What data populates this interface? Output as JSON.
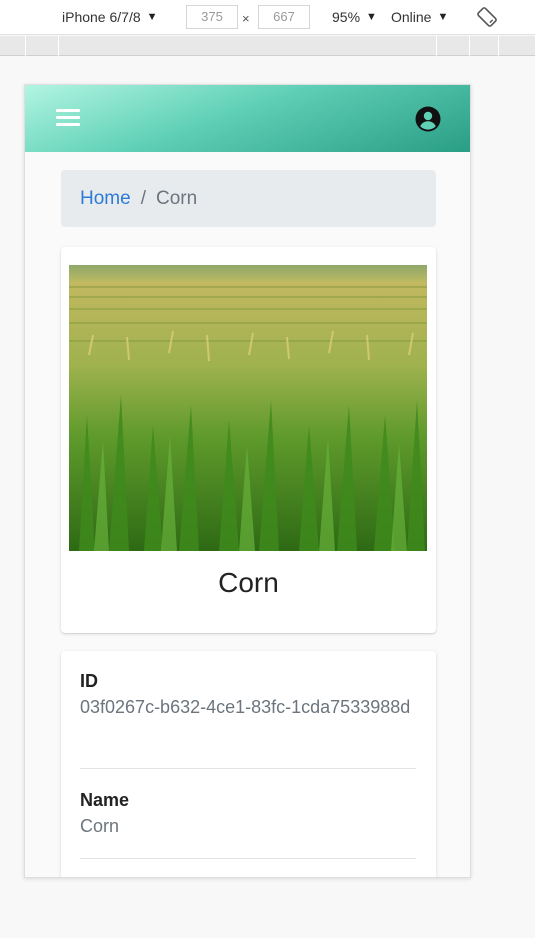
{
  "devtools": {
    "device": "iPhone 6/7/8",
    "width": "375",
    "height": "667",
    "times": "×",
    "zoom": "95%",
    "throttle": "Online",
    "caret": "▼"
  },
  "colors": {
    "appbar_start": "#b2f5e2",
    "appbar_end": "#2a9d85",
    "link": "#2e7bd6"
  },
  "breadcrumb": {
    "home": "Home",
    "separator": "/",
    "current": "Corn"
  },
  "card": {
    "image_alt": "corn-field-photo",
    "title": "Corn"
  },
  "details": {
    "id_label": "ID",
    "id_value": "03f0267c-b632-4ce1-83fc-1cda7533988d",
    "name_label": "Name",
    "name_value": "Corn"
  },
  "icons": {
    "menu": "hamburger-menu-icon",
    "account": "account-circle-icon",
    "rotate": "rotate-device-icon"
  }
}
